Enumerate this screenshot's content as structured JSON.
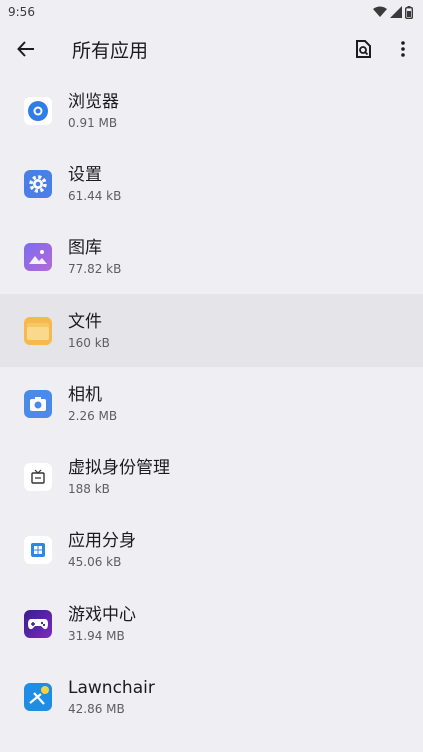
{
  "status": {
    "time": "9:56"
  },
  "appbar": {
    "title": "所有应用"
  },
  "apps": [
    {
      "name": "浏览器",
      "size": "0.91 MB",
      "icon": "browser-icon"
    },
    {
      "name": "设置",
      "size": "61.44 kB",
      "icon": "settings-icon"
    },
    {
      "name": "图库",
      "size": "77.82 kB",
      "icon": "gallery-icon"
    },
    {
      "name": "文件",
      "size": "160 kB",
      "icon": "files-icon"
    },
    {
      "name": "相机",
      "size": "2.26 MB",
      "icon": "camera-icon"
    },
    {
      "name": "虚拟身份管理",
      "size": "188 kB",
      "icon": "virtual-identity-icon"
    },
    {
      "name": "应用分身",
      "size": "45.06 kB",
      "icon": "app-clone-icon"
    },
    {
      "name": "游戏中心",
      "size": "31.94 MB",
      "icon": "game-center-icon"
    },
    {
      "name": "Lawnchair",
      "size": "42.86 MB",
      "icon": "lawnchair-icon"
    }
  ],
  "colors": {
    "background": "#efeef3",
    "selected_row": "#e5e4e9",
    "accent_blue": "#4a7fe8"
  }
}
